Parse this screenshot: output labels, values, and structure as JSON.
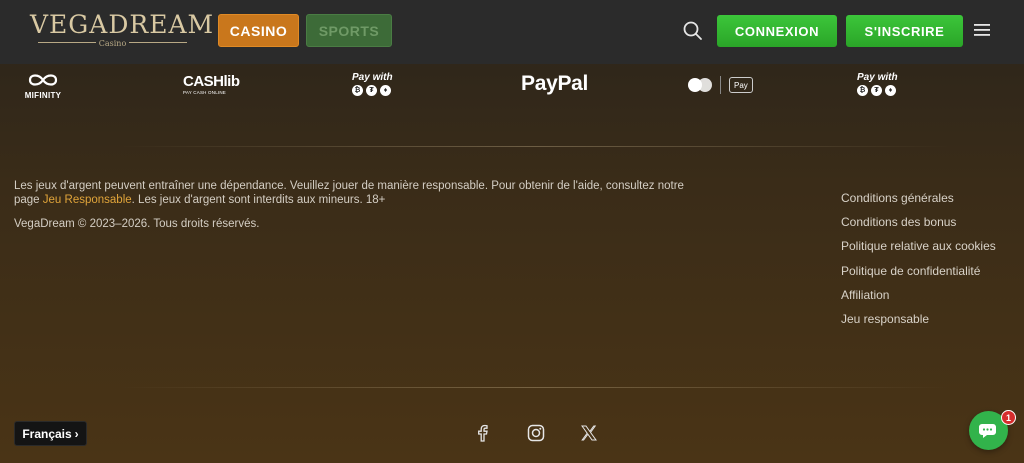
{
  "header": {
    "logo_main": "VEGADREAM",
    "logo_sub": "Casino",
    "tabs": [
      {
        "label": "CASINO",
        "active": true
      },
      {
        "label": "SPORTS",
        "active": false
      }
    ],
    "login_label": "CONNEXION",
    "signup_label": "S'INSCRIRE",
    "search_icon": "search-icon",
    "menu_icon": "hamburger-menu-icon"
  },
  "payments": {
    "mifinity": "MIFINITY",
    "cashlib": "CASHlib",
    "cashlib_sub": "PAY CASH ONLINE",
    "paywith": "Pay with",
    "paypal": "PayPal",
    "applepay": "Pay"
  },
  "footer": {
    "disclaimer_pre": "Les jeux d'argent peuvent entraîner une dépendance. Veuillez jouer de manière responsable. Pour obtenir de l'aide, consultez notre page ",
    "disclaimer_link": "Jeu Responsable",
    "disclaimer_post": ". Les jeux d'argent sont interdits aux mineurs. 18+",
    "copyright": "VegaDream © 2023–2026. Tous droits réservés.",
    "links": [
      "Conditions générales",
      "Conditions des bonus",
      "Politique relative aux cookies",
      "Politique de confidentialité",
      "Affiliation",
      "Jeu responsable"
    ],
    "language": "Français",
    "social_icons": [
      "facebook-icon",
      "instagram-icon",
      "x-icon"
    ]
  },
  "chat": {
    "badge_count": "1"
  },
  "colors": {
    "accent_orange": "#c9771c",
    "accent_green": "#2aa528",
    "link_gold": "#e0a43a"
  }
}
